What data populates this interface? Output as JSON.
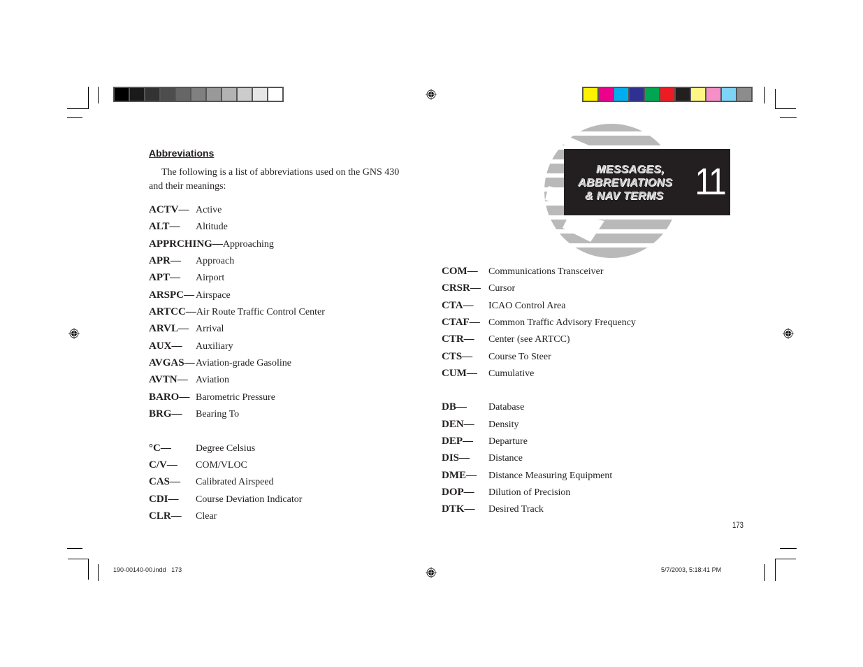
{
  "grayscale_swatches": [
    "#000000",
    "#1a1a1a",
    "#333333",
    "#4d4d4d",
    "#666666",
    "#808080",
    "#999999",
    "#b3b3b3",
    "#cccccc",
    "#e6e6e6",
    "#ffffff"
  ],
  "color_swatches": [
    "#fff200",
    "#ec008c",
    "#00aeef",
    "#2e3192",
    "#00a651",
    "#ed1c24",
    "#231f20",
    "#fff685",
    "#f68fc8",
    "#7dd4f6",
    "#8c8c8c"
  ],
  "section": {
    "title": "Abbreviations",
    "intro": "The following is a list of abbreviations used on the GNS 430 and their meanings:"
  },
  "chapter": {
    "title_lines": [
      "MESSAGES,",
      "ABBREVIATIONS",
      "& NAV TERMS"
    ],
    "number": "11",
    "icon": "globe-icon"
  },
  "left_column": [
    {
      "term": "ACTV—",
      "meaning": "Active"
    },
    {
      "term": "ALT—",
      "meaning": "Altitude"
    },
    {
      "term": "APPRCHING—",
      "meaning": "Approaching"
    },
    {
      "term": "APR—",
      "meaning": "Approach"
    },
    {
      "term": "APT—",
      "meaning": "Airport"
    },
    {
      "term": "ARSPC—",
      "meaning": "Airspace"
    },
    {
      "term": "ARTCC—",
      "meaning": "Air Route Traffic Control Center"
    },
    {
      "term": "ARVL—",
      "meaning": "Arrival"
    },
    {
      "term": "AUX—",
      "meaning": "Auxiliary"
    },
    {
      "term": "AVGAS—",
      "meaning": "Aviation-grade Gasoline"
    },
    {
      "term": "AVTN—",
      "meaning": "Aviation"
    },
    {
      "term": "BARO—",
      "meaning": "Barometric Pressure"
    },
    {
      "term": "BRG—",
      "meaning": "Bearing To"
    },
    {
      "term": "°C—",
      "meaning": "Degree Celsius"
    },
    {
      "term": "C/V—",
      "meaning": "COM/VLOC"
    },
    {
      "term": "CAS—",
      "meaning": "Calibrated Airspeed"
    },
    {
      "term": "CDI—",
      "meaning": "Course Deviation Indicator"
    },
    {
      "term": "CLR—",
      "meaning": "Clear"
    }
  ],
  "right_column": [
    {
      "term": "COM—",
      "meaning": "Communications Transceiver"
    },
    {
      "term": "CRSR—",
      "meaning": "Cursor"
    },
    {
      "term": "CTA—",
      "meaning": "ICAO Control Area"
    },
    {
      "term": "CTAF—",
      "meaning": "Common Traffic Advisory Frequency"
    },
    {
      "term": "CTR—",
      "meaning": "Center (see ARTCC)"
    },
    {
      "term": "CTS—",
      "meaning": "Course To Steer"
    },
    {
      "term": "CUM—",
      "meaning": "Cumulative"
    },
    {
      "term": "DB—",
      "meaning": "Database"
    },
    {
      "term": "DEN—",
      "meaning": "Density"
    },
    {
      "term": "DEP—",
      "meaning": "Departure"
    },
    {
      "term": "DIS—",
      "meaning": "Distance"
    },
    {
      "term": "DME—",
      "meaning": "Distance Measuring Equipment"
    },
    {
      "term": "DOP—",
      "meaning": "Dilution of Precision"
    },
    {
      "term": "DTK—",
      "meaning": "Desired Track"
    }
  ],
  "page_number": "173",
  "slug": {
    "file": "190-00140-00.indd   173",
    "timestamp": "5/7/2003, 5:18:41 PM"
  }
}
